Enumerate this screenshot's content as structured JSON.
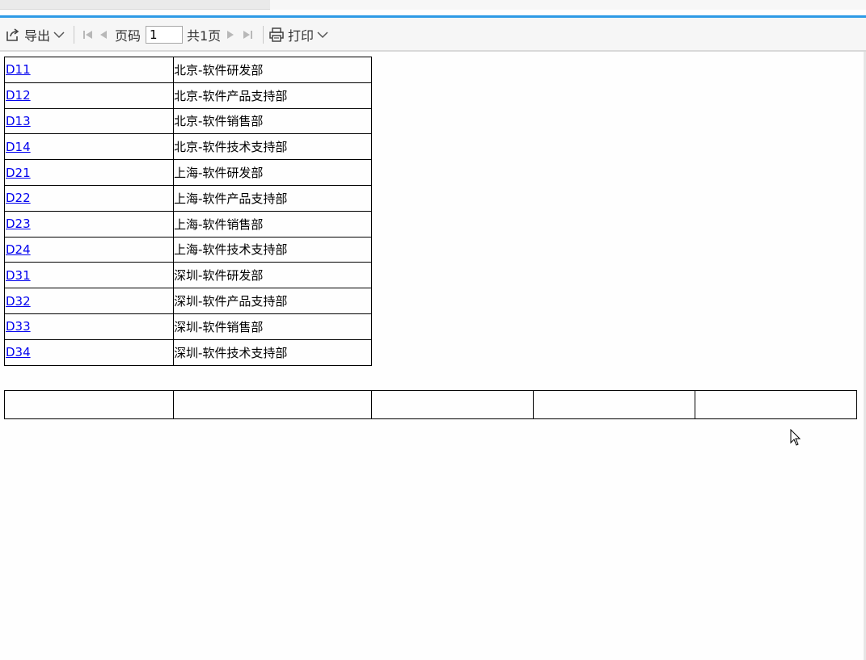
{
  "toolbar": {
    "export_label": "导出",
    "page_label": "页码",
    "page_value": "1",
    "total_label": "共1页",
    "print_label": "打印",
    "icons": {
      "export": "export-icon",
      "first": "first-page-icon",
      "prev": "prev-page-icon",
      "next": "next-page-icon",
      "last": "last-page-icon",
      "print": "print-icon",
      "dropdown": "chevron-down-icon"
    }
  },
  "departments": [
    {
      "code": "D11",
      "name": "北京-软件研发部"
    },
    {
      "code": "D12",
      "name": "北京-软件产品支持部"
    },
    {
      "code": "D13",
      "name": "北京-软件销售部"
    },
    {
      "code": "D14",
      "name": "北京-软件技术支持部"
    },
    {
      "code": "D21",
      "name": "上海-软件研发部"
    },
    {
      "code": "D22",
      "name": "上海-软件产品支持部"
    },
    {
      "code": "D23",
      "name": "上海-软件销售部"
    },
    {
      "code": "D24",
      "name": "上海-软件技术支持部"
    },
    {
      "code": "D31",
      "name": "深圳-软件研发部"
    },
    {
      "code": "D32",
      "name": "深圳-软件产品支持部"
    },
    {
      "code": "D33",
      "name": "深圳-软件销售部"
    },
    {
      "code": "D34",
      "name": "深圳-软件技术支持部"
    }
  ],
  "colors": {
    "accent": "#2f9be6",
    "link": "#0000ee",
    "toolbar_bg": "#f6f6f6"
  }
}
